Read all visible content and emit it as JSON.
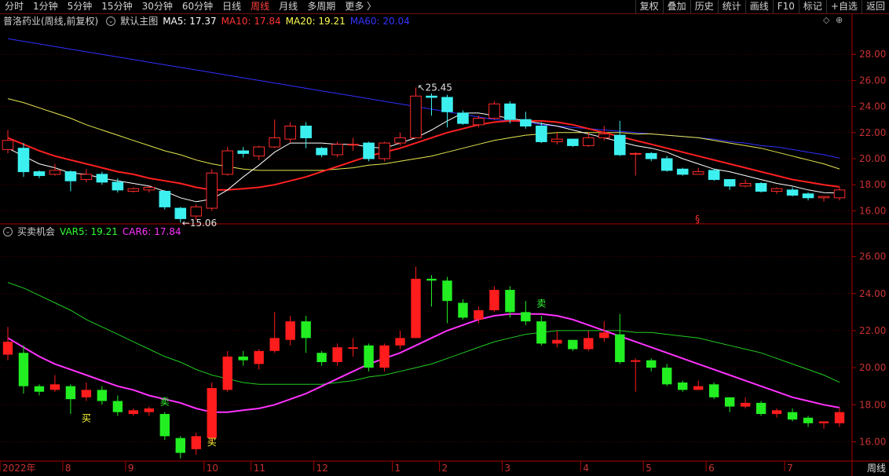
{
  "toolbar": {
    "tabs": [
      "分时",
      "1分钟",
      "5分钟",
      "15分钟",
      "30分钟",
      "60分钟",
      "日线",
      "周线",
      "月线",
      "多周期",
      "更多 〉"
    ],
    "active_index": 7,
    "right_buttons": [
      "复权",
      "叠加",
      "历史",
      "统计",
      "画线",
      "F10",
      "标记",
      "+自选",
      "返回"
    ]
  },
  "main_legend": {
    "stock": "普洛药业(周线,前复权)",
    "template": "默认主图",
    "ma5": {
      "label": "MA5: 17.37",
      "color": "#ffffff"
    },
    "ma10": {
      "label": "MA10: 17.84",
      "color": "#ff3333"
    },
    "ma20": {
      "label": "MA20: 19.21",
      "color": "#ffff55"
    },
    "ma60": {
      "label": "MA60: 20.04",
      "color": "#3030ff"
    }
  },
  "sub_legend": {
    "name": "买卖机会",
    "var5": {
      "label": "VAR5: 19.21",
      "color": "#33ff33"
    },
    "car6": {
      "label": "CAR6: 17.84",
      "color": "#ff33ff"
    }
  },
  "period_button": "周线",
  "colors": {
    "up": "#ff2a2a",
    "down": "#3df0f0",
    "sub_up": "#ff1c1c",
    "sub_down": "#22ee22",
    "grid": "#550000",
    "axis": "#aa0000",
    "text": "#c83232"
  },
  "chart_data": {
    "type": "candlestick",
    "x_axis_labels": [
      {
        "label": "2022年",
        "index": 0
      },
      {
        "label": "8",
        "index": 4
      },
      {
        "label": "9",
        "index": 8
      },
      {
        "label": "10",
        "index": 13
      },
      {
        "label": "11",
        "index": 16
      },
      {
        "label": "12",
        "index": 20
      },
      {
        "label": "1",
        "index": 25
      },
      {
        "label": "2",
        "index": 28
      },
      {
        "label": "3",
        "index": 32
      },
      {
        "label": "4",
        "index": 37
      },
      {
        "label": "5",
        "index": 41
      },
      {
        "label": "6",
        "index": 45
      },
      {
        "label": "7",
        "index": 50
      }
    ],
    "main_y_ticks": [
      16.0,
      18.0,
      20.0,
      22.0,
      24.0,
      26.0,
      28.0
    ],
    "main_ylim": [
      15.0,
      30.0
    ],
    "sub_y_ticks": [
      16.0,
      18.0,
      20.0,
      22.0,
      24.0,
      26.0
    ],
    "sub_ylim": [
      15.0,
      27.0
    ],
    "candles": [
      [
        20.7,
        21.4,
        20.4,
        22.2
      ],
      [
        20.8,
        19.0,
        18.6,
        21.2
      ],
      [
        19.0,
        18.7,
        18.5,
        19.1
      ],
      [
        18.8,
        19.1,
        18.7,
        19.6
      ],
      [
        19.0,
        18.3,
        17.5,
        19.1
      ],
      [
        18.4,
        18.8,
        18.2,
        19.2
      ],
      [
        18.8,
        18.2,
        18.0,
        19.0
      ],
      [
        18.2,
        17.6,
        17.4,
        18.5
      ],
      [
        17.5,
        17.7,
        17.4,
        17.8
      ],
      [
        17.6,
        17.8,
        17.4,
        17.9
      ],
      [
        17.5,
        16.3,
        16.1,
        17.6
      ],
      [
        16.2,
        15.4,
        15.1,
        16.3
      ],
      [
        15.6,
        16.3,
        15.3,
        16.5
      ],
      [
        16.2,
        18.9,
        16.0,
        19.2
      ],
      [
        18.8,
        20.6,
        18.7,
        20.9
      ],
      [
        20.6,
        20.4,
        20.1,
        20.9
      ],
      [
        20.2,
        20.9,
        19.9,
        21.0
      ],
      [
        20.9,
        21.6,
        20.8,
        23.0
      ],
      [
        21.5,
        22.5,
        21.2,
        22.8
      ],
      [
        22.5,
        21.6,
        20.8,
        22.8
      ],
      [
        20.8,
        20.3,
        20.1,
        20.9
      ],
      [
        20.3,
        21.1,
        20.1,
        21.3
      ],
      [
        21.1,
        21.1,
        20.6,
        21.6
      ],
      [
        21.2,
        20.0,
        19.8,
        21.3
      ],
      [
        20.0,
        21.2,
        19.8,
        21.3
      ],
      [
        21.2,
        21.6,
        21.0,
        22.0
      ],
      [
        21.6,
        24.8,
        21.6,
        25.45
      ],
      [
        24.8,
        24.7,
        23.3,
        25.0
      ],
      [
        24.7,
        23.6,
        22.4,
        24.9
      ],
      [
        23.5,
        22.7,
        22.6,
        23.7
      ],
      [
        22.6,
        23.1,
        22.4,
        23.3
      ],
      [
        23.1,
        24.2,
        23.0,
        24.4
      ],
      [
        24.2,
        23.0,
        22.7,
        24.4
      ],
      [
        23.0,
        22.5,
        22.3,
        23.6
      ],
      [
        22.5,
        21.3,
        21.2,
        22.8
      ],
      [
        21.3,
        21.5,
        21.1,
        22.0
      ],
      [
        21.5,
        21.0,
        20.9,
        21.5
      ],
      [
        21.0,
        21.6,
        20.9,
        22.0
      ],
      [
        21.6,
        21.9,
        21.4,
        22.5
      ],
      [
        21.8,
        20.3,
        20.2,
        22.9
      ],
      [
        20.4,
        20.4,
        18.7,
        20.5
      ],
      [
        20.4,
        20.0,
        19.8,
        20.5
      ],
      [
        20.0,
        19.1,
        19.0,
        20.2
      ],
      [
        19.2,
        18.8,
        18.7,
        19.3
      ],
      [
        18.8,
        19.0,
        18.8,
        19.3
      ],
      [
        19.1,
        18.4,
        18.3,
        19.2
      ],
      [
        18.4,
        17.9,
        17.6,
        18.4
      ],
      [
        17.9,
        18.1,
        17.8,
        18.4
      ],
      [
        18.1,
        17.5,
        17.4,
        18.2
      ],
      [
        17.5,
        17.7,
        17.3,
        17.8
      ],
      [
        17.6,
        17.2,
        17.1,
        17.8
      ],
      [
        17.3,
        17.0,
        16.8,
        17.4
      ],
      [
        17.0,
        17.1,
        16.7,
        17.1
      ],
      [
        17.0,
        17.6,
        16.8,
        17.8
      ]
    ],
    "ma5": [
      20.8,
      20.2,
      19.6,
      19.3,
      18.9,
      18.8,
      18.5,
      18.3,
      18.1,
      17.9,
      17.5,
      17.0,
      16.7,
      16.9,
      17.6,
      18.6,
      19.5,
      20.5,
      21.2,
      21.2,
      21.2,
      21.1,
      21.1,
      20.9,
      20.8,
      21.2,
      21.6,
      22.2,
      22.9,
      23.5,
      23.5,
      23.3,
      23.1,
      22.9,
      22.7,
      22.5,
      22.2,
      21.9,
      21.6,
      21.3,
      21.0,
      20.8,
      20.5,
      20.0,
      19.6,
      19.2,
      19.0,
      18.7,
      18.4,
      18.1,
      17.9,
      17.6,
      17.4,
      17.37
    ],
    "ma10": [
      21.6,
      21.1,
      20.6,
      20.2,
      19.9,
      19.6,
      19.3,
      19.0,
      18.8,
      18.5,
      18.3,
      18.1,
      17.8,
      17.6,
      17.6,
      17.7,
      17.8,
      18.0,
      18.3,
      18.6,
      19.0,
      19.4,
      19.8,
      20.2,
      20.5,
      20.8,
      21.2,
      21.6,
      22.0,
      22.3,
      22.6,
      22.8,
      22.9,
      22.9,
      22.9,
      22.8,
      22.6,
      22.3,
      22.0,
      21.7,
      21.4,
      21.1,
      20.8,
      20.5,
      20.2,
      19.9,
      19.6,
      19.3,
      19.0,
      18.7,
      18.4,
      18.2,
      18.0,
      17.84
    ],
    "ma20": [
      24.6,
      24.3,
      23.9,
      23.5,
      23.1,
      22.6,
      22.2,
      21.8,
      21.4,
      21.0,
      20.6,
      20.3,
      19.9,
      19.6,
      19.4,
      19.2,
      19.1,
      19.1,
      19.1,
      19.1,
      19.1,
      19.2,
      19.3,
      19.5,
      19.6,
      19.8,
      20.0,
      20.2,
      20.5,
      20.8,
      21.1,
      21.4,
      21.6,
      21.8,
      21.9,
      22.0,
      22.0,
      22.0,
      22.0,
      22.0,
      21.9,
      21.9,
      21.8,
      21.7,
      21.6,
      21.4,
      21.2,
      21.0,
      20.8,
      20.5,
      20.2,
      19.9,
      19.6,
      19.21
    ],
    "ma60": [
      29.2,
      29.0,
      28.8,
      28.6,
      28.4,
      28.2,
      28.0,
      27.8,
      27.6,
      27.4,
      27.2,
      27.0,
      26.8,
      26.6,
      26.4,
      26.2,
      26.0,
      25.8,
      25.6,
      25.4,
      25.2,
      25.0,
      24.8,
      24.6,
      24.4,
      24.2,
      24.0,
      23.8,
      23.6,
      23.4,
      23.2,
      23.0,
      22.9,
      22.8,
      22.6,
      22.5,
      22.4,
      22.3,
      22.2,
      22.1,
      22.0,
      21.9,
      21.8,
      21.7,
      21.6,
      21.5,
      21.3,
      21.2,
      21.0,
      20.9,
      20.7,
      20.5,
      20.3,
      20.04
    ],
    "var5": [
      24.6,
      24.3,
      23.9,
      23.5,
      23.1,
      22.6,
      22.2,
      21.8,
      21.4,
      21.0,
      20.6,
      20.3,
      19.9,
      19.6,
      19.4,
      19.2,
      19.1,
      19.1,
      19.1,
      19.1,
      19.1,
      19.2,
      19.3,
      19.5,
      19.6,
      19.8,
      20.0,
      20.2,
      20.5,
      20.8,
      21.1,
      21.4,
      21.6,
      21.8,
      21.9,
      22.0,
      22.0,
      22.0,
      22.0,
      22.0,
      21.9,
      21.9,
      21.8,
      21.7,
      21.6,
      21.4,
      21.2,
      21.0,
      20.8,
      20.5,
      20.2,
      19.9,
      19.6,
      19.21
    ],
    "car6": [
      21.6,
      21.1,
      20.6,
      20.2,
      19.9,
      19.6,
      19.3,
      19.0,
      18.8,
      18.5,
      18.3,
      18.1,
      17.8,
      17.6,
      17.6,
      17.7,
      17.8,
      18.0,
      18.3,
      18.6,
      19.0,
      19.4,
      19.8,
      20.2,
      20.5,
      20.8,
      21.2,
      21.6,
      22.0,
      22.3,
      22.6,
      22.8,
      22.9,
      22.9,
      22.9,
      22.8,
      22.6,
      22.3,
      22.0,
      21.7,
      21.4,
      21.1,
      20.8,
      20.5,
      20.2,
      19.9,
      19.6,
      19.3,
      19.0,
      18.7,
      18.4,
      18.2,
      18.0,
      17.84
    ],
    "annotations": {
      "high": {
        "label": "25.45",
        "index": 26
      },
      "low": {
        "label": "15.06",
        "index": 11
      }
    },
    "signals": [
      {
        "text": "买",
        "index": 5,
        "value": 17.1,
        "color": "#ffff33"
      },
      {
        "text": "卖",
        "index": 10,
        "value": 18.0,
        "color": "#33ff33"
      },
      {
        "text": "买",
        "index": 13,
        "value": 15.8,
        "color": "#ffff33"
      },
      {
        "text": "卖",
        "index": 34,
        "value": 23.3,
        "color": "#33ff33"
      }
    ],
    "event_marker": {
      "text": "§",
      "index": 44
    }
  }
}
